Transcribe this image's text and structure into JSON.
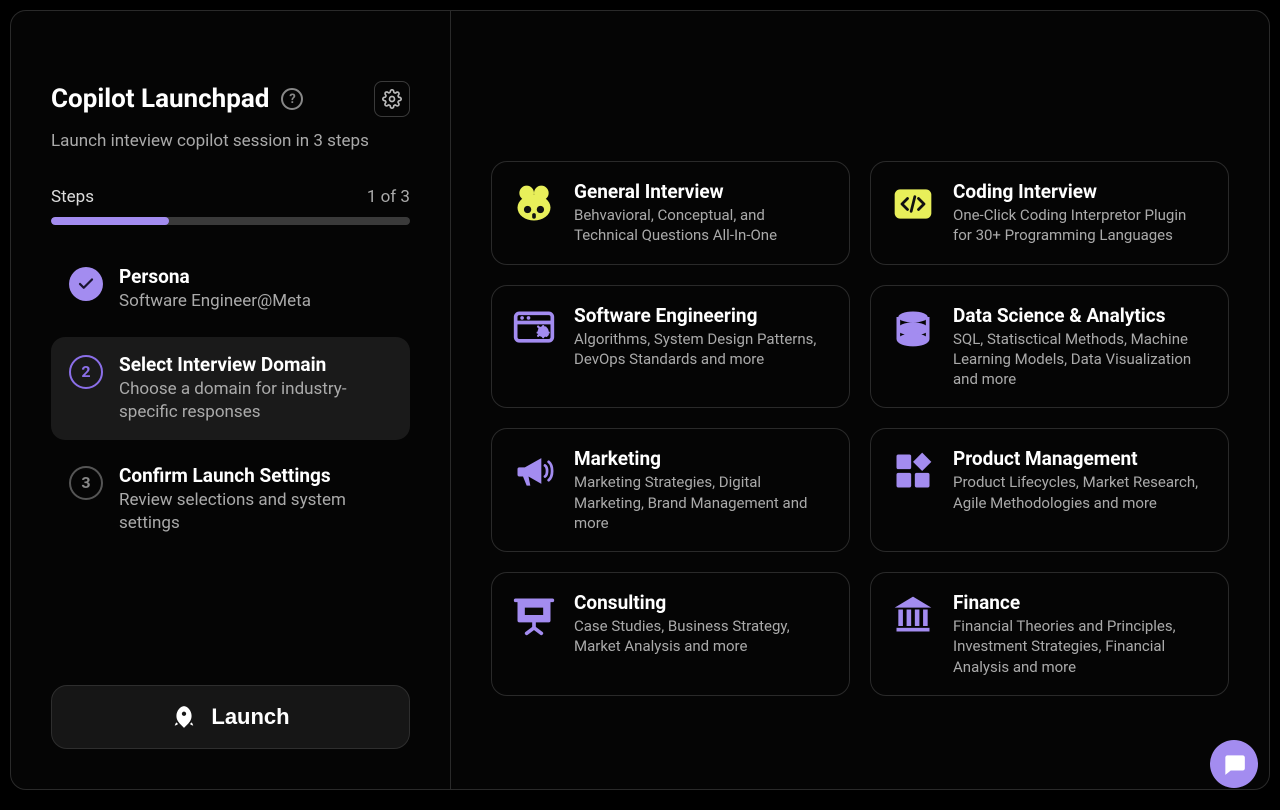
{
  "header": {
    "title": "Copilot Launchpad",
    "subtitle": "Launch inteview copilot session in 3 steps"
  },
  "progress": {
    "label": "Steps",
    "counter": "1 of 3",
    "percent": 33
  },
  "steps": [
    {
      "title": "Persona",
      "desc": "Software Engineer@Meta",
      "state": "done"
    },
    {
      "title": "Select Interview Domain",
      "desc": "Choose a domain for industry-specific responses",
      "state": "current",
      "number": "2"
    },
    {
      "title": "Confirm Launch Settings",
      "desc": "Review selections and system settings",
      "state": "pending",
      "number": "3"
    }
  ],
  "launch_label": "Launch",
  "domains": [
    {
      "icon": "copilot",
      "title": "General Interview",
      "desc": "Behvavioral, Conceptual, and Technical Questions All-In-One"
    },
    {
      "icon": "code",
      "title": "Coding Interview",
      "desc": "One-Click Coding Interpretor Plugin for 30+ Programming Languages"
    },
    {
      "icon": "browser",
      "title": "Software Engineering",
      "desc": "Algorithms, System Design Patterns, DevOps Standards and more"
    },
    {
      "icon": "database",
      "title": "Data Science & Analytics",
      "desc": "SQL, Statisctical Methods, Machine Learning Models, Data Visualization and more"
    },
    {
      "icon": "megaphone",
      "title": "Marketing",
      "desc": "Marketing Strategies, Digital Marketing, Brand Management and more"
    },
    {
      "icon": "grid",
      "title": "Product Management",
      "desc": "Product Lifecycles, Market Research, Agile Methodologies and more"
    },
    {
      "icon": "presentation",
      "title": "Consulting",
      "desc": "Case Studies, Business Strategy, Market Analysis and more"
    },
    {
      "icon": "bank",
      "title": "Finance",
      "desc": "Financial Theories and Principles, Investment Strategies, Financial Analysis and more"
    }
  ],
  "colors": {
    "accent": "#a38cf0",
    "icon_yellow": "#e8ef5a",
    "icon_purple": "#a38cf0"
  }
}
